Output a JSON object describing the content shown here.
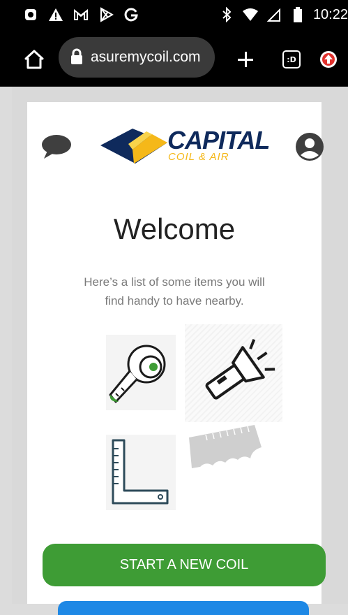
{
  "status_bar": {
    "time": "10:22",
    "left_icons": [
      "app-icon",
      "warning-icon",
      "gmail-icon",
      "play-store-icon",
      "google-icon"
    ],
    "right_icons": [
      "bluetooth-icon",
      "wifi-icon",
      "signal-icon",
      "battery-icon"
    ]
  },
  "browser": {
    "url": "asuremycoil.com",
    "tab_count_label": ":D"
  },
  "header": {
    "logo_main": "CAPITAL",
    "logo_sub": "COIL & AIR"
  },
  "main": {
    "title": "Welcome",
    "subtitle": "Here’s a list of some items you will find handy to have nearby.",
    "tools": [
      "tape-measure-icon",
      "flashlight-icon",
      "carpenter-square-icon",
      "key-blank-icon"
    ],
    "start_button_label": "START A NEW COIL"
  },
  "colors": {
    "brand_navy": "#0f2a5c",
    "brand_yellow": "#f5b819",
    "start_green": "#3e9c35"
  }
}
